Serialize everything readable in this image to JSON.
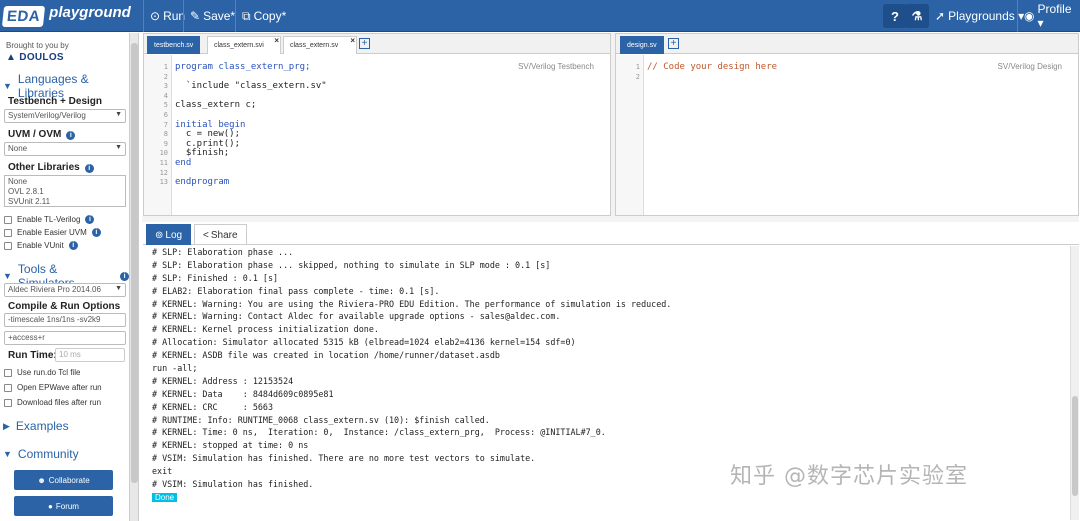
{
  "topbar": {
    "logo_eda": "EDA",
    "logo_playground": "playground",
    "run_label": "Run",
    "save_label": "Save*",
    "copy_label": "Copy*",
    "help_label": "?",
    "playgrounds_label": "Playgrounds ▾",
    "profile_label": "Profile ▾"
  },
  "sidebar": {
    "brought_by": "Brought to you by",
    "sponsor": "DOULOS",
    "languages_header": "Languages & Libraries",
    "testbench_design_label": "Testbench + Design",
    "testbench_design_value": "SystemVerilog/Verilog",
    "uvm_label": "UVM / OVM",
    "uvm_value": "None",
    "other_libs_label": "Other Libraries",
    "other_libs_options": [
      "None",
      "OVL 2.8.1",
      "SVUnit 2.11"
    ],
    "checks": [
      "Enable TL-Verilog",
      "Enable Easier UVM",
      "Enable VUnit"
    ],
    "tools_header": "Tools & Simulators",
    "simulator_value": "Aldec Riviera Pro 2014.06",
    "compile_run_label": "Compile & Run Options",
    "compile_options_value": "-timescale 1ns/1ns -sv2k9",
    "run_options_value": "+access+r",
    "run_time_label": "Run Time:",
    "run_time_placeholder": "10 ms",
    "use_run_do": "Use run.do Tcl file",
    "open_epwave": "Open EPWave after run",
    "download_files": "Download files after run",
    "examples_header": "Examples",
    "community_header": "Community",
    "collaborate_label": "Collaborate",
    "forum_label": "Forum"
  },
  "testbench_pane": {
    "tabs": [
      "testbench.sv",
      "class_extern.svi",
      "class_extern.sv"
    ],
    "mode": "SV/Verilog Testbench",
    "line_numbers": [
      "1",
      "2",
      "3",
      "4",
      "5",
      "6",
      "7",
      "8",
      "9",
      "10",
      "11",
      "12",
      "13"
    ],
    "lines": [
      "program class_extern_prg;",
      "",
      "  `include \"class_extern.sv\"",
      "",
      "class_extern c;",
      "",
      "initial begin",
      "  c = new();",
      "  c.print();",
      "  $finish;",
      "end",
      "",
      "endprogram"
    ]
  },
  "design_pane": {
    "tabs": [
      "design.sv"
    ],
    "mode": "SV/Verilog Design",
    "line_numbers": [
      "1",
      "2"
    ],
    "lines": [
      "// Code your design here",
      ""
    ]
  },
  "log": {
    "tabs": [
      "Log",
      "Share"
    ],
    "lines": [
      "# SLP: Elaboration phase ...",
      "# SLP: Elaboration phase ... skipped, nothing to simulate in SLP mode : 0.1 [s]",
      "# SLP: Finished : 0.1 [s]",
      "# ELAB2: Elaboration final pass complete - time: 0.1 [s].",
      "# KERNEL: Warning: You are using the Riviera-PRO EDU Edition. The performance of simulation is reduced.",
      "# KERNEL: Warning: Contact Aldec for available upgrade options - sales@aldec.com.",
      "# KERNEL: Kernel process initialization done.",
      "# Allocation: Simulator allocated 5315 kB (elbread=1024 elab2=4136 kernel=154 sdf=0)",
      "# KERNEL: ASDB file was created in location /home/runner/dataset.asdb",
      "run -all;",
      "# KERNEL: Address : 12153524",
      "# KERNEL: Data    : 8484d609c0895e81",
      "# KERNEL: CRC     : 5663",
      "# RUNTIME: Info: RUNTIME_0068 class_extern.sv (10): $finish called.",
      "# KERNEL: Time: 0 ns,  Iteration: 0,  Instance: /class_extern_prg,  Process: @INITIAL#7_0.",
      "# KERNEL: stopped at time: 0 ns",
      "# VSIM: Simulation has finished. There are no more test vectors to simulate.",
      "exit",
      "# VSIM: Simulation has finished."
    ],
    "done_label": "Done"
  },
  "watermark": "知乎 @数字芯片实验室"
}
